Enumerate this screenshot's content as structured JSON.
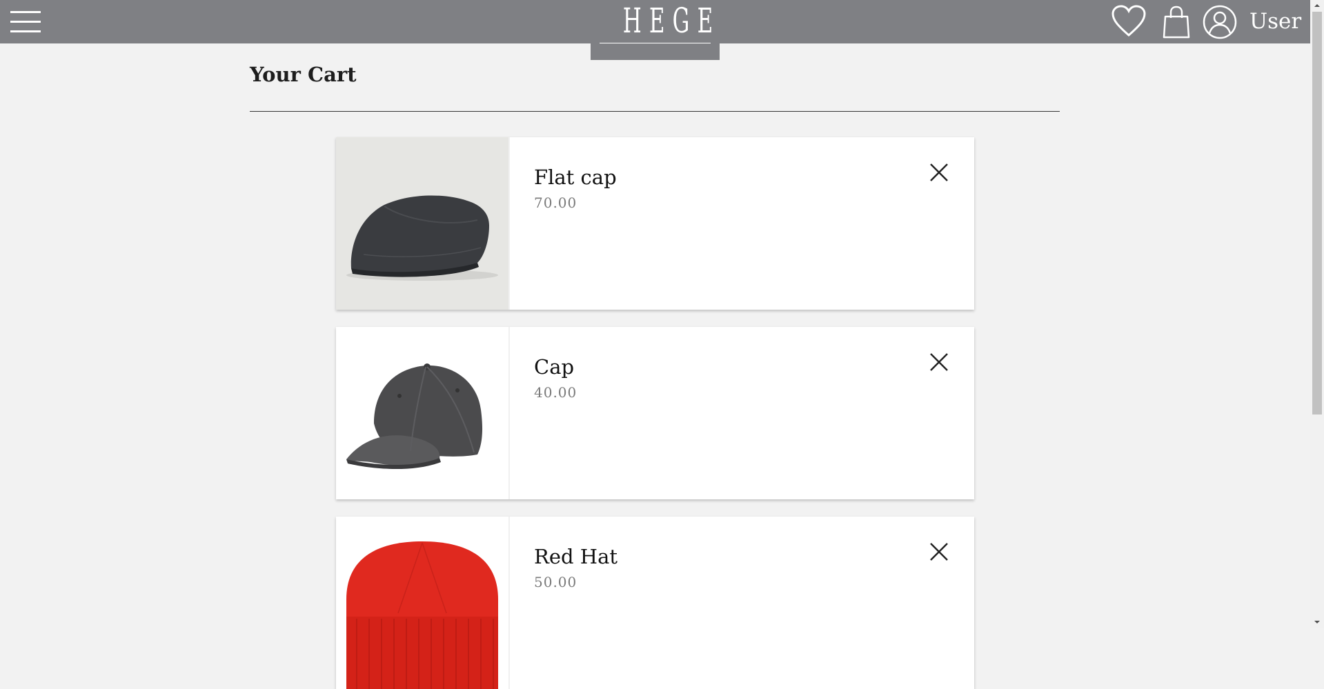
{
  "header": {
    "brand": "HEGE",
    "user_label": "User"
  },
  "page": {
    "title": "Your Cart"
  },
  "cart": {
    "items": [
      {
        "name": "Flat cap",
        "price": "70.00"
      },
      {
        "name": "Cap",
        "price": "40.00"
      },
      {
        "name": "Red Hat",
        "price": "50.00"
      }
    ]
  },
  "colors": {
    "header_bg": "#7f8084",
    "page_bg": "#f2f2f2",
    "price_text": "#7a7a7a",
    "hat_red": "#e0291f"
  }
}
